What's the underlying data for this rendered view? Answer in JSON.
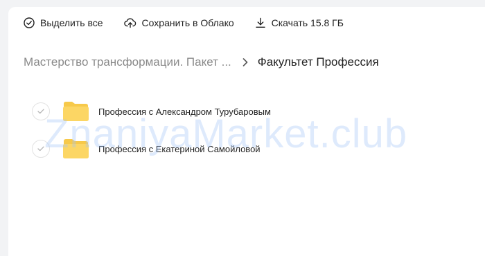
{
  "toolbar": {
    "select_all": "Выделить все",
    "save_to_cloud": "Сохранить в Облако",
    "download": "Скачать 15.8 ГБ"
  },
  "breadcrumb": {
    "parent": "Мастерство трансформации. Пакет ...",
    "current": "Факультет Профессия"
  },
  "items": [
    {
      "name": "Профессия с Александром Турубаровым",
      "type": "folder-icon"
    },
    {
      "name": "Профессия с Екатериной Самойловой",
      "type": "folder-icon"
    }
  ],
  "watermark": "ZnaniyaMarket.club",
  "colors": {
    "folder": "#fcd664",
    "folder_tab": "#f7c94a",
    "muted_text": "#8a8a8a",
    "text": "#222222",
    "watermark": "#a0c3f5"
  }
}
